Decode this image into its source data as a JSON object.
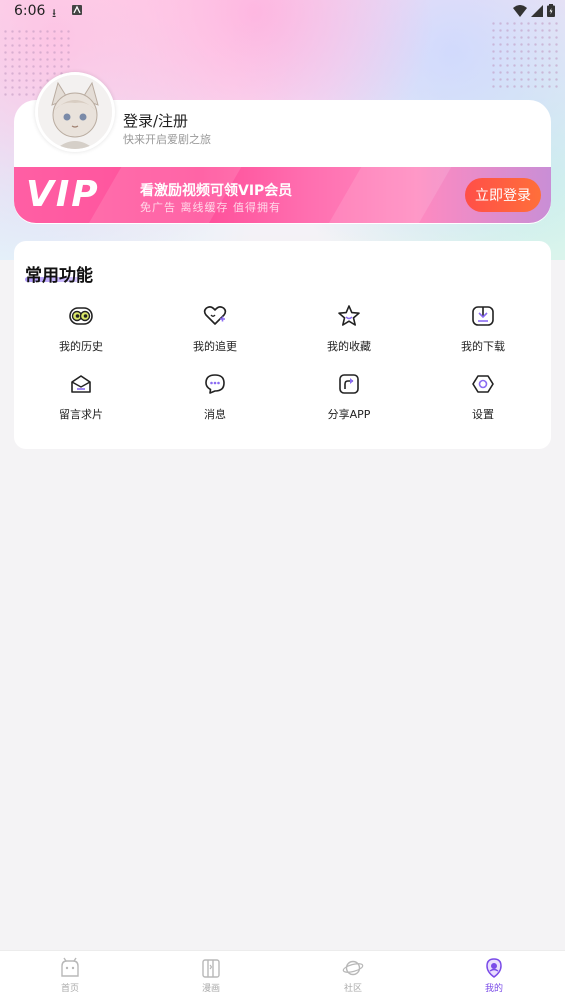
{
  "status_bar": {
    "time": "6:06"
  },
  "profile": {
    "title": "登录/注册",
    "subtitle": "快来开启爱剧之旅"
  },
  "vip_banner": {
    "logo": "VIP",
    "headline": "看激励视频可领VIP会员",
    "tagline": "免广告 离线缓存 值得拥有",
    "button": "立即登录"
  },
  "functions": {
    "title": "常用功能",
    "items": [
      {
        "label": "我的历史",
        "icon": "history-eyes-icon"
      },
      {
        "label": "我的追更",
        "icon": "follow-heart-icon"
      },
      {
        "label": "我的收藏",
        "icon": "star-icon"
      },
      {
        "label": "我的下载",
        "icon": "download-icon"
      },
      {
        "label": "留言求片",
        "icon": "mail-icon"
      },
      {
        "label": "消息",
        "icon": "chat-bubble-icon"
      },
      {
        "label": "分享APP",
        "icon": "share-icon"
      },
      {
        "label": "设置",
        "icon": "settings-hexagon-icon"
      }
    ]
  },
  "tabs": [
    {
      "label": "首页",
      "icon": "home-icon",
      "active": false
    },
    {
      "label": "漫画",
      "icon": "comic-icon",
      "active": false
    },
    {
      "label": "社区",
      "icon": "planet-icon",
      "active": false
    },
    {
      "label": "我的",
      "icon": "profile-icon",
      "active": true
    }
  ],
  "colors": {
    "accent": "#7a4be8",
    "vip_pink": "#ff4f9a",
    "login_button": "#ff5544"
  }
}
